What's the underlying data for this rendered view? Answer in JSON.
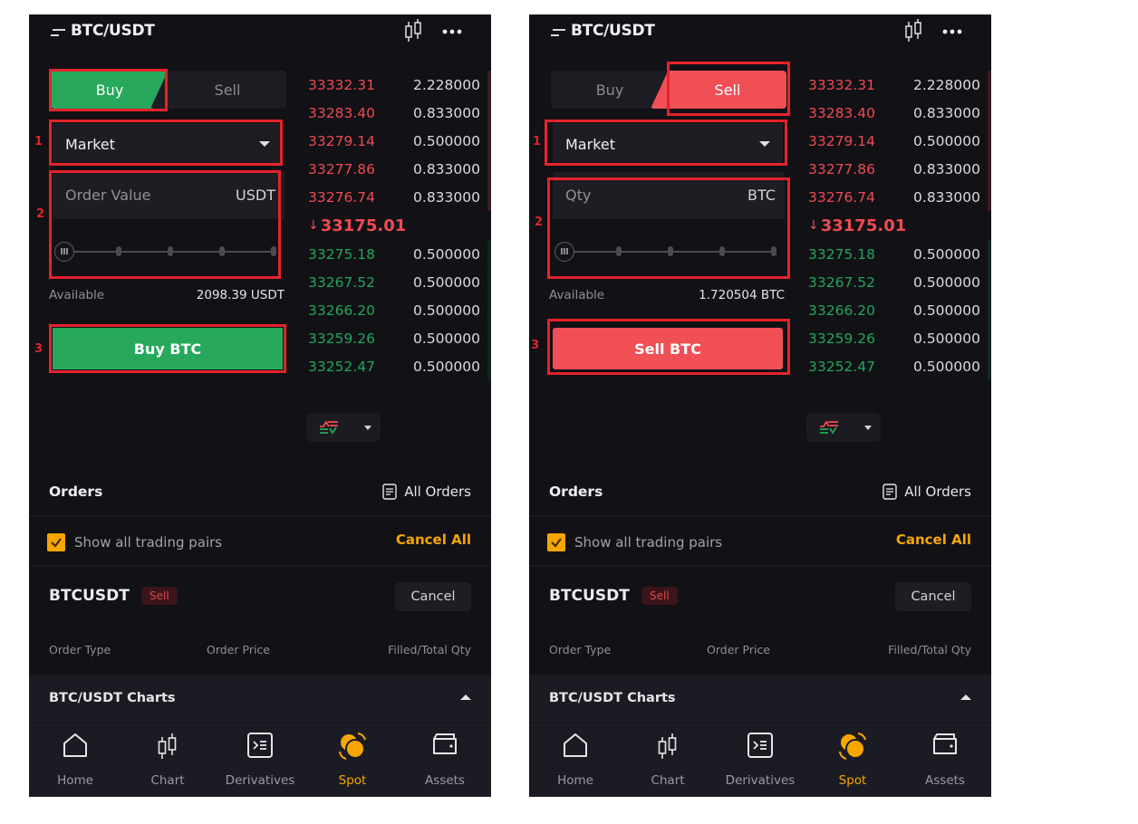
{
  "colors": {
    "buy": "#27a85c",
    "sell": "#f04f55",
    "accent": "#f7a600",
    "annotation": "#e5232b",
    "background": "#111116"
  },
  "header": {
    "pair": "BTC/USDT",
    "icons": [
      "menu-icon",
      "candlestick-chart-icon",
      "more-icon"
    ]
  },
  "order_book": {
    "asks": [
      {
        "price": "33332.31",
        "qty": "2.228000"
      },
      {
        "price": "33283.40",
        "qty": "0.833000"
      },
      {
        "price": "33279.14",
        "qty": "0.500000"
      },
      {
        "price": "33277.86",
        "qty": "0.833000"
      },
      {
        "price": "33276.74",
        "qty": "0.833000"
      }
    ],
    "last_price": "33175.01",
    "last_price_arrow": "↓",
    "bids": [
      {
        "price": "33275.18",
        "qty": "0.500000"
      },
      {
        "price": "33267.52",
        "qty": "0.500000"
      },
      {
        "price": "33266.20",
        "qty": "0.500000"
      },
      {
        "price": "33259.26",
        "qty": "0.500000"
      },
      {
        "price": "33252.47",
        "qty": "0.500000"
      }
    ]
  },
  "annotations": [
    "1",
    "2",
    "3"
  ],
  "screens": [
    {
      "side": "buy",
      "tabs": {
        "buy": "Buy",
        "sell": "Sell",
        "active": "buy"
      },
      "order_type": "Market",
      "input": {
        "label": "Order Value",
        "unit": "USDT",
        "value": ""
      },
      "slider": {
        "percent": 0,
        "stops": [
          0,
          25,
          50,
          75,
          100
        ]
      },
      "available": {
        "label": "Available",
        "value": "2098.39 USDT"
      },
      "action_button": "Buy BTC"
    },
    {
      "side": "sell",
      "tabs": {
        "buy": "Buy",
        "sell": "Sell",
        "active": "sell"
      },
      "order_type": "Market",
      "input": {
        "label": "Qty",
        "unit": "BTC",
        "value": ""
      },
      "slider": {
        "percent": 0,
        "stops": [
          0,
          25,
          50,
          75,
          100
        ]
      },
      "available": {
        "label": "Available",
        "value": "1.720504 BTC"
      },
      "action_button": "Sell BTC"
    }
  ],
  "orders": {
    "title": "Orders",
    "all_orders": "All Orders",
    "show_all_pairs": {
      "label": "Show all trading pairs",
      "checked": true
    },
    "cancel_all": "Cancel All",
    "items": [
      {
        "symbol": "BTCUSDT",
        "side": "Sell",
        "cancel": "Cancel",
        "columns": [
          "Order Type",
          "Order Price",
          "Filled/Total Qty"
        ]
      }
    ]
  },
  "charts_bar": {
    "label": "BTC/USDT Charts"
  },
  "bottom_nav": [
    {
      "label": "Home",
      "icon": "home-icon",
      "active": false
    },
    {
      "label": "Chart",
      "icon": "candlestick-icon",
      "active": false
    },
    {
      "label": "Derivatives",
      "icon": "derivatives-icon",
      "active": false
    },
    {
      "label": "Spot",
      "icon": "spot-icon",
      "active": true
    },
    {
      "label": "Assets",
      "icon": "wallet-icon",
      "active": false
    }
  ]
}
